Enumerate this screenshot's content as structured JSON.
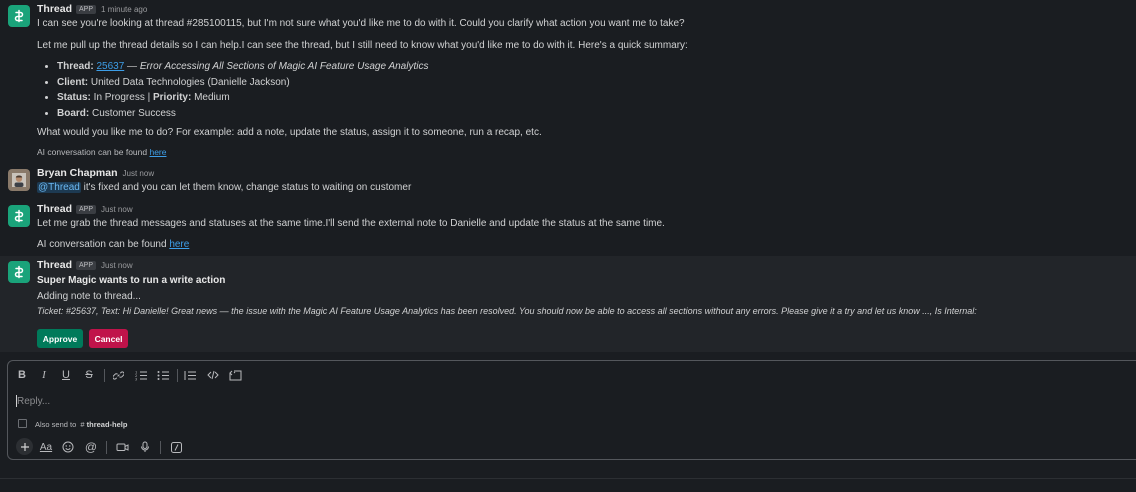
{
  "msg1": {
    "sender": "Thread",
    "badge": "APP",
    "time": "1 minute ago",
    "line1": "I can see you're looking at thread #285100115, but I'm not sure what you'd like me to do with it. Could you clarify what action you want me to take?",
    "line2": "Let me pull up the thread details so I can help.I can see the thread, but I still need to know what you'd like me to do with it. Here's a quick summary:",
    "summary": {
      "thread_label": "Thread:",
      "thread_id": "25637",
      "thread_title": " — Error Accessing All Sections of Magic AI Feature Usage Analytics",
      "client_label": "Client:",
      "client_value": " United Data Technologies (Danielle Jackson)",
      "status_label": "Status:",
      "status_value": " In Progress | ",
      "priority_label": "Priority:",
      "priority_value": " Medium",
      "board_label": "Board:",
      "board_value": " Customer Success"
    },
    "question": "What would you like me to do? For example: add a note, update the status, assign it to someone, run a recap, etc.",
    "ai_prefix": "AI conversation can be found ",
    "ai_link": "here"
  },
  "msg2": {
    "sender": "Bryan Chapman",
    "time": "Just now",
    "mention": "@Thread",
    "text": " it's fixed and you can let them know, change status to waiting on customer"
  },
  "msg3": {
    "sender": "Thread",
    "badge": "APP",
    "time": "Just now",
    "text": "Let me grab the thread messages and statuses at the same time.I'll send the external note to Danielle and update the status at the same time.",
    "ai_prefix": "AI conversation can be found ",
    "ai_link": "here"
  },
  "msg4": {
    "sender": "Thread",
    "badge": "APP",
    "time": "Just now",
    "heading": "Super Magic wants to run a write action",
    "sub": "Adding note to thread...",
    "detail": "Ticket: #25637, Text: Hi Danielle! Great news — the issue with the Magic AI Feature Usage Analytics has been resolved. You should now be able to access all sections without any errors. Please give it a try and let us know ..., Is Internal:",
    "approve": "Approve",
    "cancel": "Cancel",
    "approve_color": "#007a5a",
    "cancel_color": "#c0134a"
  },
  "composer": {
    "toolbar": [
      "B",
      "I",
      "U",
      "S"
    ],
    "placeholder": "Reply...",
    "also_send_label": "Also send to",
    "channel_hash": "#",
    "channel": "thread-help",
    "aa": "Aa"
  }
}
